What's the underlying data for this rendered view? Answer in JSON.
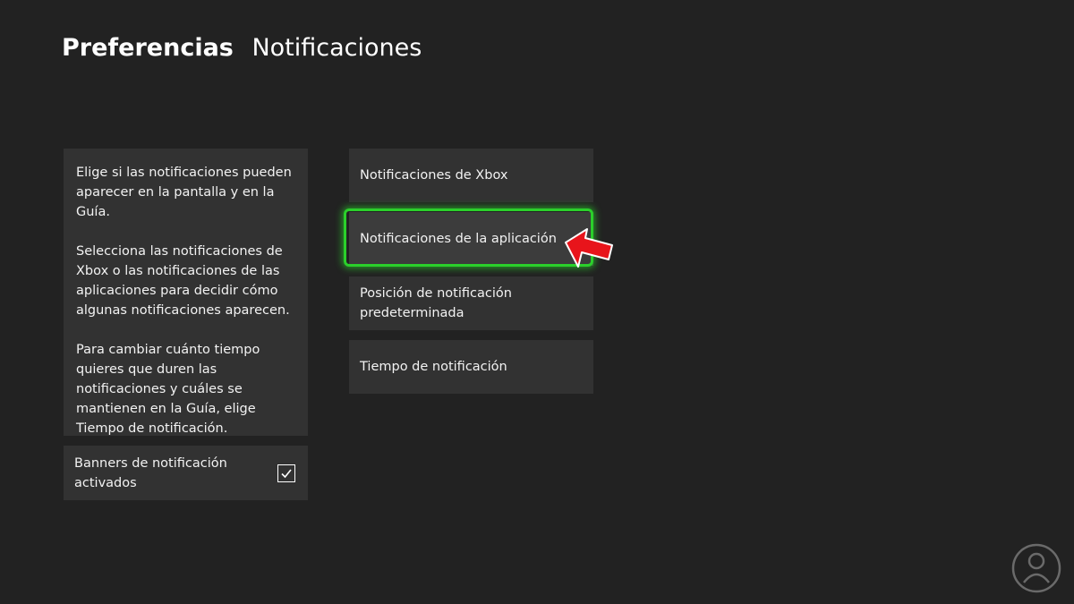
{
  "header": {
    "section": "Preferencias",
    "page": "Notificaciones"
  },
  "info_panel": {
    "paragraphs": [
      "Elige si las notificaciones pueden aparecer en la pantalla y en la Guía.",
      "Selecciona las notificaciones de Xbox o las notificaciones de las aplicaciones para decidir cómo algunas notificaciones aparecen.",
      "Para cambiar cuánto tiempo quieres que duren las notificaciones y cuáles se mantienen en la Guía, elige Tiempo de notificación."
    ]
  },
  "toggle": {
    "label": "Banners de notificación activados",
    "checked": true
  },
  "menu": {
    "items": [
      {
        "label": "Notificaciones de Xbox"
      },
      {
        "label": "Notificaciones de la aplicación",
        "focused": true
      },
      {
        "label": "Posición de notificación predeterminada"
      },
      {
        "label": "Tiempo de notificación"
      }
    ]
  },
  "colors": {
    "background": "#222222",
    "panel": "#323232",
    "focus": "#2bd02b",
    "arrow": "#e8141b"
  },
  "icons": {
    "checkbox": "checkmark-icon",
    "pointer": "red-arrow-icon",
    "watermark": "logo-icon"
  }
}
